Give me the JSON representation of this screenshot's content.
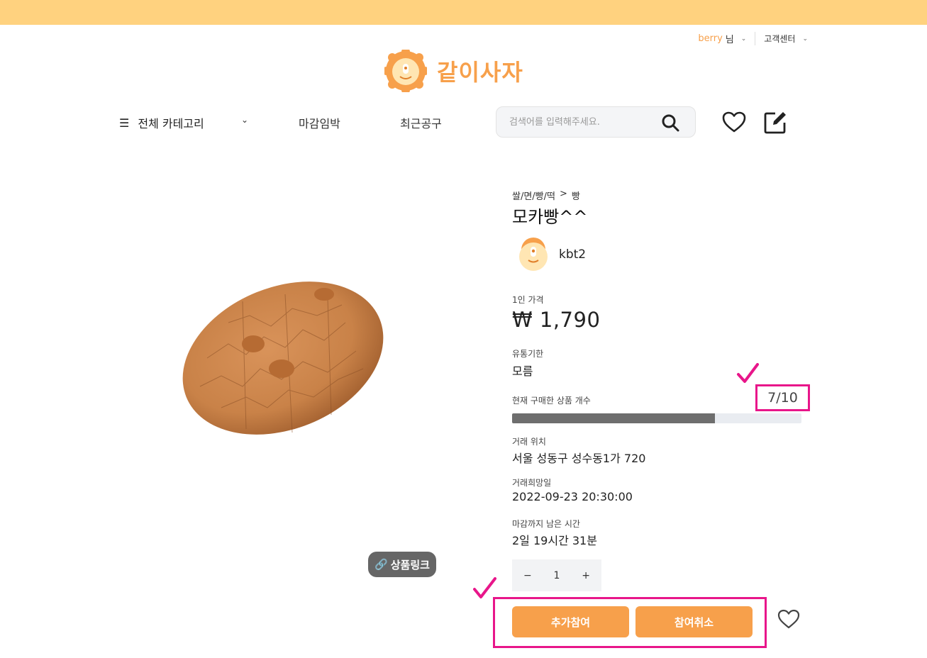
{
  "header": {
    "user_name": "berry",
    "user_suffix": "님",
    "customer_center": "고객센터"
  },
  "logo": {
    "text": "같이사자",
    "icon": "lion-logo-icon"
  },
  "nav": {
    "category": "전체 카테고리",
    "link_deadline": "마감임박",
    "link_recent": "최근공구",
    "search_placeholder": "검색어를 입력해주세요."
  },
  "product": {
    "breadcrumb_parent": "쌀/면/빵/떡",
    "breadcrumb_sep": ">",
    "breadcrumb_child": "빵",
    "title": "모카빵^^",
    "seller": "kbt2",
    "price_label": "1인 가격",
    "price": "₩ 1,790",
    "expiry_label": "유통기한",
    "expiry": "모름",
    "purchase_label": "현재 구매한 상품 개수",
    "purchase_count": "7/10",
    "purchase_ratio": 0.7,
    "location_label": "거래 위치",
    "location": "서울 성동구 성수동1가 720",
    "date_label": "거래희망일",
    "date": "2022-09-23 20:30:00",
    "remaining_label": "마감까지 남은 시간",
    "remaining": "2일 19시간 31분",
    "link_label": "상품링크"
  },
  "quantity": {
    "minus": "−",
    "value": "1",
    "plus": "+"
  },
  "actions": {
    "join": "추가참여",
    "cancel": "참여취소"
  },
  "colors": {
    "accent": "#f7a04b",
    "banner": "#ffd27f",
    "highlight": "#e8168a"
  }
}
